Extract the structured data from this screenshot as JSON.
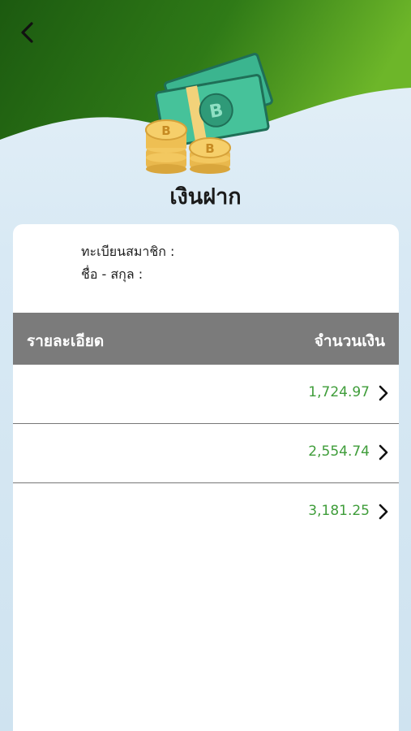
{
  "header": {
    "title": "เงินฝาก",
    "back_icon": "chevron-left-icon",
    "hero_icon": "bitcoin-money-icon",
    "colors": {
      "dark_green": "#1d5b12",
      "light_green": "#6cb528"
    }
  },
  "member": {
    "member_id_label": "ทะเบียนสมาชิก :",
    "name_label": "ชื่อ - สกุล :"
  },
  "table": {
    "col_detail": "รายละเอียด",
    "col_amount": "จำนวนเงิน",
    "rows": [
      {
        "amount": "1,724.97"
      },
      {
        "amount": "2,554.74"
      },
      {
        "amount": "3,181.25"
      }
    ],
    "amount_color": "#3f9d3a",
    "row_icon": "chevron-right-icon"
  }
}
